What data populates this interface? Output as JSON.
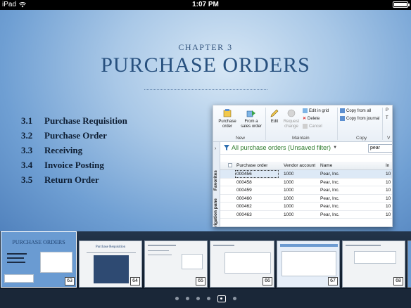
{
  "status_bar": {
    "device": "iPad",
    "time": "1:07 PM",
    "battery_level": 1.0
  },
  "slide": {
    "chapter": "CHAPTER 3",
    "title": "PURCHASE ORDERS",
    "toc": [
      {
        "num": "3.1",
        "label": "Purchase Requisition"
      },
      {
        "num": "3.2",
        "label": "Purchase Order"
      },
      {
        "num": "3.3",
        "label": "Receiving"
      },
      {
        "num": "3.4",
        "label": "Invoice Posting"
      },
      {
        "num": "3.5",
        "label": "Return Order"
      }
    ]
  },
  "app": {
    "ribbon": {
      "purchase_order": "Purchase\norder",
      "from_sales_order": "From a\nsales order",
      "edit": "Edit",
      "request_change": "Request\nchange",
      "edit_in_grid": "Edit in grid",
      "delete": "Delete",
      "cancel": "Cancel",
      "copy_from_all": "Copy from all",
      "copy_from_journal": "Copy from journal",
      "group_new": "New",
      "group_maintain": "Maintain",
      "group_copy": "Copy",
      "cut_p": "P",
      "cut_t": "T",
      "cut_v": "V"
    },
    "rail": {
      "favorites": "Favorites",
      "navigation_pane": "vigation pane"
    },
    "filter": {
      "title": "All purchase orders (Unsaved filter)",
      "value": "pear"
    },
    "grid": {
      "columns": [
        "Purchase order",
        "Vendor account",
        "Name",
        "In"
      ],
      "rows": [
        {
          "po": "000456",
          "vendor": "1000",
          "name": "Pear, Inc.",
          "extra": "10"
        },
        {
          "po": "000458",
          "vendor": "1000",
          "name": "Pear, Inc.",
          "extra": "10"
        },
        {
          "po": "000459",
          "vendor": "1000",
          "name": "Pear, Inc.",
          "extra": "10"
        },
        {
          "po": "000460",
          "vendor": "1000",
          "name": "Pear, Inc.",
          "extra": "10"
        },
        {
          "po": "000462",
          "vendor": "1000",
          "name": "Pear, Inc.",
          "extra": "10"
        },
        {
          "po": "000463",
          "vendor": "1000",
          "name": "Pear, Inc.",
          "extra": "10"
        }
      ]
    }
  },
  "thumbnails": [
    {
      "page": "63",
      "active": true,
      "title": "PURCHASE ORDERS"
    },
    {
      "page": "64",
      "active": false,
      "title": "Purchase Requisition"
    },
    {
      "page": "65",
      "active": false,
      "title": ""
    },
    {
      "page": "66",
      "active": false,
      "title": ""
    },
    {
      "page": "67",
      "active": false,
      "title": ""
    },
    {
      "page": "68",
      "active": false,
      "title": ""
    }
  ],
  "page_dots": {
    "count": 6,
    "current": 5
  }
}
